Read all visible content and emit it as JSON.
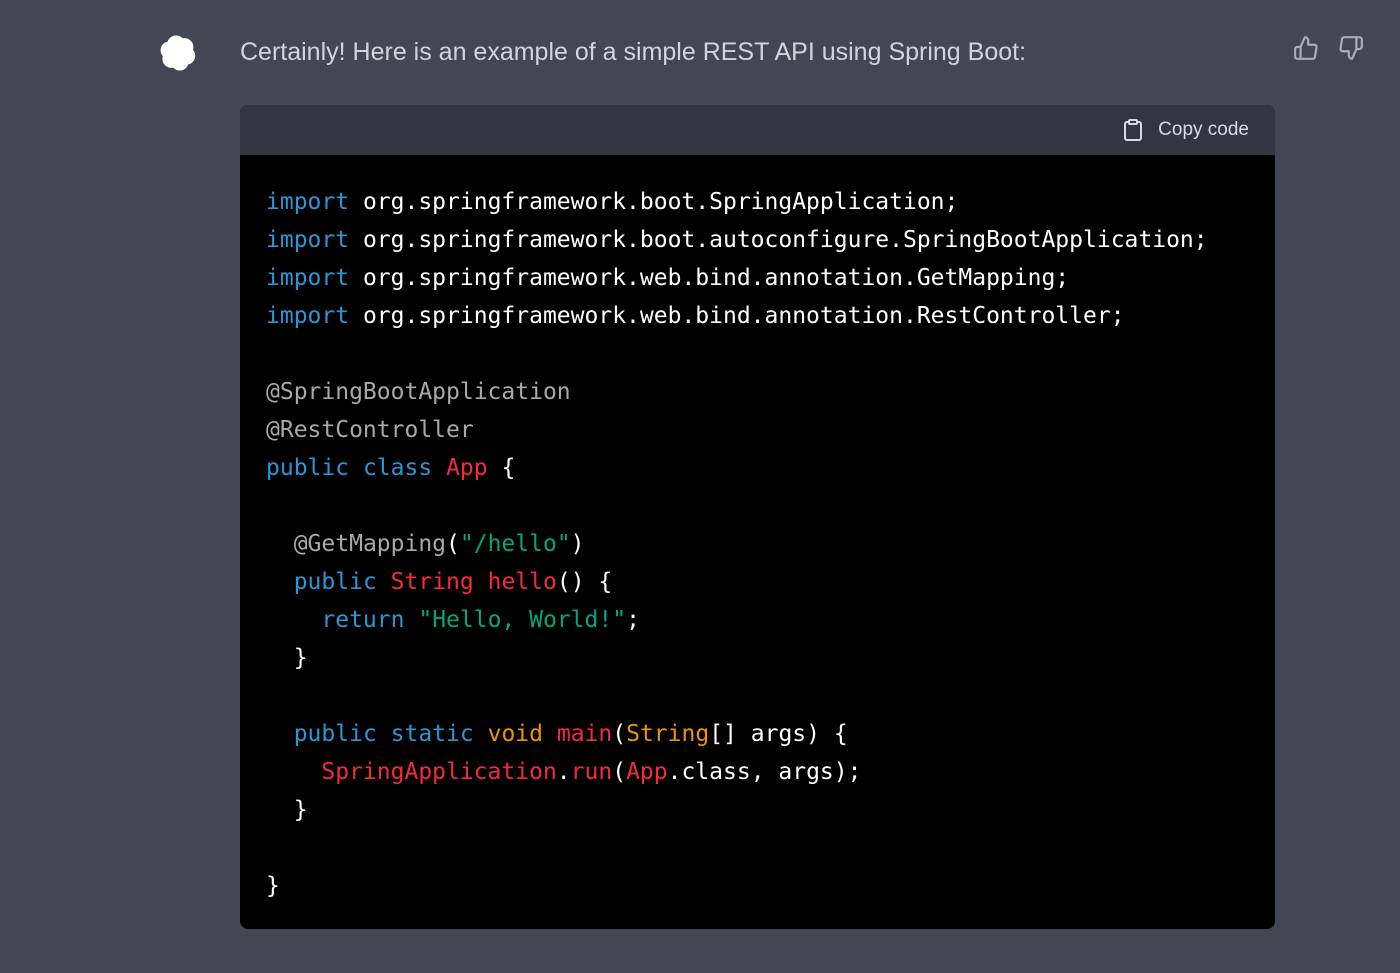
{
  "message": {
    "text": "Certainly! Here is an example of a simple REST API using Spring Boot:"
  },
  "icons": {
    "avatar": "openai-logo-icon",
    "thumbs_up": "thumbs-up-icon",
    "thumbs_down": "thumbs-down-icon",
    "clipboard": "clipboard-icon"
  },
  "colors": {
    "background": "#444654",
    "avatar_bg": "#10a37f",
    "code_bg": "#000000",
    "code_header_bg": "#343541",
    "keyword": "#2e95d3",
    "annotation": "#a9a9a9",
    "string": "#00a67d",
    "class_name": "#f22c3d",
    "type": "#e9950c"
  },
  "code_block": {
    "copy_label": "Copy code",
    "lines": [
      [
        [
          "keyword",
          "import"
        ],
        [
          "plain",
          " org.springframework.boot.SpringApplication;"
        ]
      ],
      [
        [
          "keyword",
          "import"
        ],
        [
          "plain",
          " org.springframework.boot.autoconfigure.SpringBootApplication;"
        ]
      ],
      [
        [
          "keyword",
          "import"
        ],
        [
          "plain",
          " org.springframework.web.bind.annotation.GetMapping;"
        ]
      ],
      [
        [
          "keyword",
          "import"
        ],
        [
          "plain",
          " org.springframework.web.bind.annotation.RestController;"
        ]
      ],
      [],
      [
        [
          "annotation",
          "@SpringBootApplication"
        ]
      ],
      [
        [
          "annotation",
          "@RestController"
        ]
      ],
      [
        [
          "keyword",
          "public"
        ],
        [
          "plain",
          " "
        ],
        [
          "keyword",
          "class"
        ],
        [
          "plain",
          " "
        ],
        [
          "class",
          "App"
        ],
        [
          "plain",
          " {"
        ]
      ],
      [],
      [
        [
          "plain",
          "  "
        ],
        [
          "annotation",
          "@GetMapping"
        ],
        [
          "plain",
          "("
        ],
        [
          "string",
          "\"/hello\""
        ],
        [
          "plain",
          ")"
        ]
      ],
      [
        [
          "plain",
          "  "
        ],
        [
          "keyword",
          "public"
        ],
        [
          "plain",
          " "
        ],
        [
          "class",
          "String"
        ],
        [
          "plain",
          " "
        ],
        [
          "func",
          "hello"
        ],
        [
          "plain",
          "() {"
        ]
      ],
      [
        [
          "plain",
          "    "
        ],
        [
          "keyword",
          "return"
        ],
        [
          "plain",
          " "
        ],
        [
          "string",
          "\"Hello, World!\""
        ],
        [
          "plain",
          ";"
        ]
      ],
      [
        [
          "plain",
          "  }"
        ]
      ],
      [],
      [
        [
          "plain",
          "  "
        ],
        [
          "keyword",
          "public"
        ],
        [
          "plain",
          " "
        ],
        [
          "keyword",
          "static"
        ],
        [
          "plain",
          " "
        ],
        [
          "type",
          "void"
        ],
        [
          "plain",
          " "
        ],
        [
          "func",
          "main"
        ],
        [
          "plain",
          "("
        ],
        [
          "type",
          "String"
        ],
        [
          "plain",
          "[] args) {"
        ]
      ],
      [
        [
          "plain",
          "    "
        ],
        [
          "class",
          "SpringApplication"
        ],
        [
          "plain",
          "."
        ],
        [
          "func",
          "run"
        ],
        [
          "plain",
          "("
        ],
        [
          "class",
          "App"
        ],
        [
          "plain",
          ".class, args);"
        ]
      ],
      [
        [
          "plain",
          "  }"
        ]
      ],
      [],
      [
        [
          "plain",
          "}"
        ]
      ]
    ]
  }
}
